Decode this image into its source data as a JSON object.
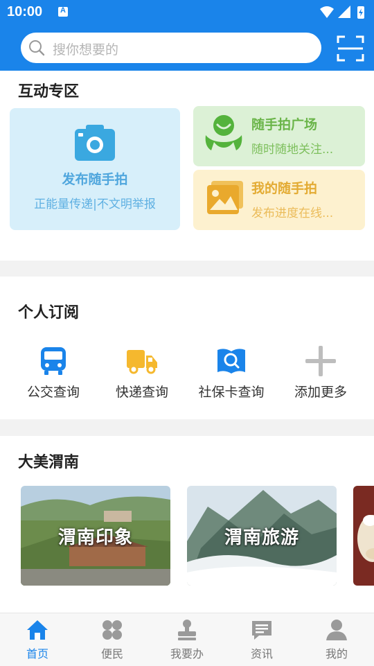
{
  "status": {
    "time": "10:00"
  },
  "search": {
    "placeholder": "搜你想要的"
  },
  "interaction": {
    "title": "互动专区",
    "publish": {
      "title": "发布随手拍",
      "subtitle": "正能量传递|不文明举报"
    },
    "square": {
      "title": "随手拍广场",
      "subtitle": "随时随地关注..."
    },
    "mine": {
      "title": "我的随手拍",
      "subtitle": "发布进度在线..."
    }
  },
  "subscription": {
    "title": "个人订阅",
    "items": [
      {
        "label": "公交查询",
        "icon": "bus-icon"
      },
      {
        "label": "快递查询",
        "icon": "truck-icon"
      },
      {
        "label": "社保卡查询",
        "icon": "book-search-icon"
      },
      {
        "label": "添加更多",
        "icon": "plus-icon"
      }
    ]
  },
  "beauty": {
    "title": "大美渭南",
    "cards": [
      {
        "label": "渭南印象"
      },
      {
        "label": "渭南旅游"
      },
      {
        "label": ""
      }
    ]
  },
  "tabs": [
    {
      "label": "首页",
      "icon": "home-icon",
      "active": true
    },
    {
      "label": "便民",
      "icon": "clover-icon",
      "active": false
    },
    {
      "label": "我要办",
      "icon": "stamp-icon",
      "active": false
    },
    {
      "label": "资讯",
      "icon": "message-icon",
      "active": false
    },
    {
      "label": "我的",
      "icon": "user-icon",
      "active": false
    }
  ],
  "colors": {
    "primary": "#1a84ea",
    "green": "#6bb54a",
    "orange": "#e9b33e",
    "publish_blue": "#4fa6dd"
  }
}
